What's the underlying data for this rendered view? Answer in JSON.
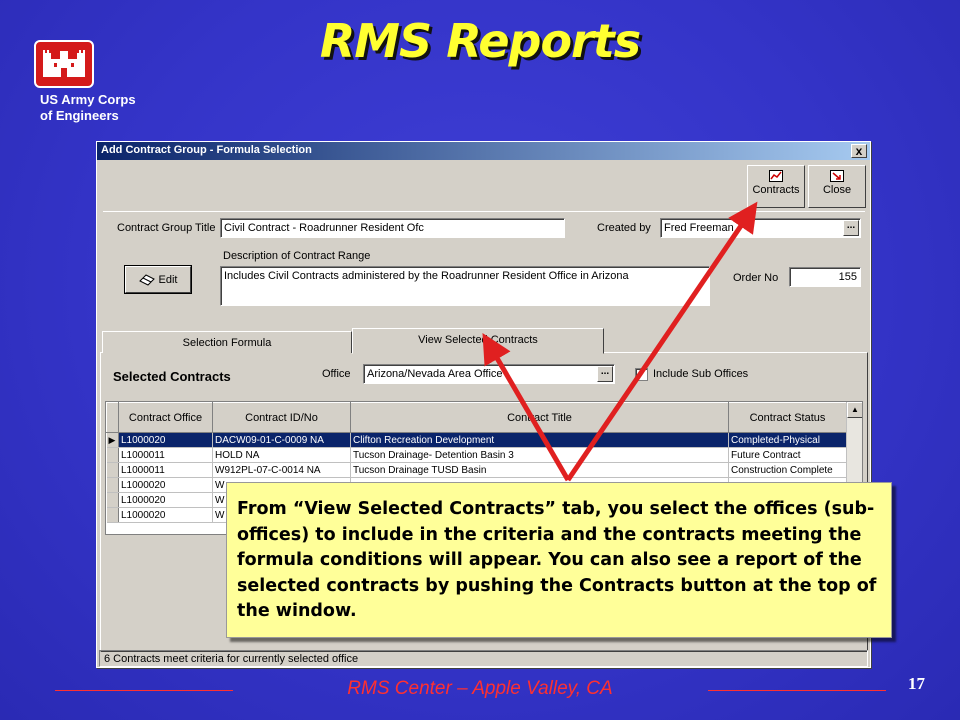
{
  "slide": {
    "title": "RMS Reports",
    "org_line1": "US Army Corps",
    "org_line2": "of Engineers",
    "footer": "RMS Center – Apple Valley, CA",
    "page_number": "17",
    "callout": "From “View Selected Contracts” tab, you select the offices (sub-offices) to include in the criteria and the contracts meeting the formula conditions will appear. You can also see a report of the selected contracts by pushing the Contracts button at the top of the window."
  },
  "window": {
    "title": "Add Contract Group - Formula Selection",
    "close": "x",
    "toolbar": {
      "contracts_label": "Contracts",
      "close_label": "Close"
    },
    "form": {
      "group_title_label": "Contract Group Title",
      "group_title_value": "Civil Contract - Roadrunner Resident Ofc",
      "created_by_label": "Created by",
      "created_by_value": "Fred Freeman",
      "description_label": "Description of Contract Range",
      "description_value": "Includes Civil Contracts administered by the Roadrunner Resident Office in Arizona",
      "order_no_label": "Order No",
      "order_no_value": "155",
      "edit_label": "Edit",
      "ellipsis": "..."
    },
    "tabs": [
      {
        "label": "Selection Formula",
        "active": false
      },
      {
        "label": "View Selected Contracts",
        "active": true
      }
    ],
    "panel": {
      "heading": "Selected Contracts",
      "office_label": "Office",
      "office_value": "Arizona/Nevada Area Office",
      "include_sub_label": "Include Sub Offices",
      "include_sub_checked": false
    },
    "grid": {
      "headers": [
        "Contract Office",
        "Contract ID/No",
        "Contract Title",
        "Contract Status"
      ],
      "rows": [
        {
          "office": "L1000020",
          "id": "DACW09-01-C-0009 NA",
          "title": "Clifton Recreation Development",
          "status": "Completed-Physical",
          "selected": true
        },
        {
          "office": "L1000011",
          "id": "HOLD NA",
          "title": "Tucson Drainage- Detention Basin 3",
          "status": "Future Contract",
          "selected": false
        },
        {
          "office": "L1000011",
          "id": "W912PL-07-C-0014 NA",
          "title": "Tucson Drainage TUSD Basin",
          "status": "Construction Complete",
          "selected": false
        },
        {
          "office": "L1000020",
          "id": "W",
          "title": "",
          "status": "",
          "selected": false
        },
        {
          "office": "L1000020",
          "id": "W",
          "title": "",
          "status": "",
          "selected": false
        },
        {
          "office": "L1000020",
          "id": "W",
          "title": "",
          "status": "",
          "selected": false
        }
      ]
    },
    "status_bar": "6 Contracts meet criteria for currently selected office"
  },
  "colors": {
    "background": "#3434c8",
    "title": "#ffff30",
    "arrow": "#e02020",
    "callout_bg": "#ffff99",
    "footer": "#ff3030",
    "selection": "#0a246a"
  }
}
